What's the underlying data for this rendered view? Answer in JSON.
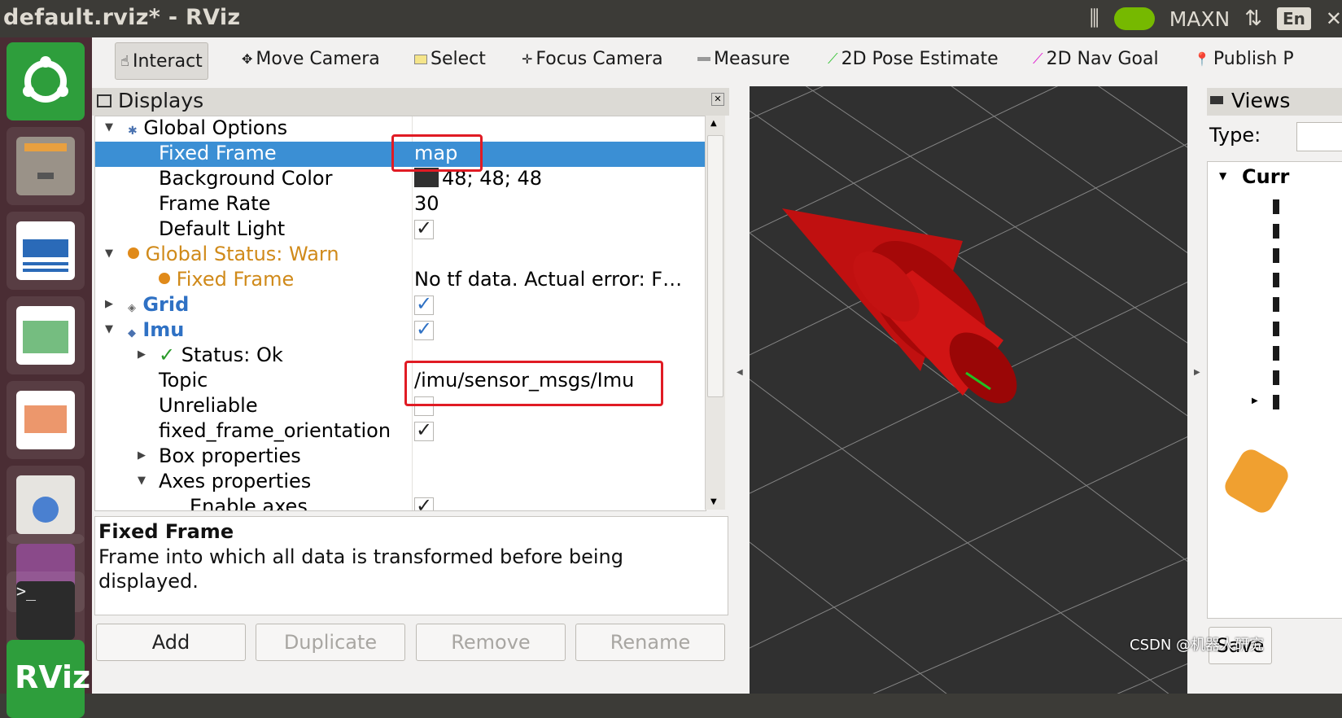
{
  "window": {
    "title": "default.rviz* - RViz",
    "tray": {
      "power_mode": "MAXN",
      "keyboard": "En"
    }
  },
  "toolbar": {
    "tools": [
      {
        "label": "Interact",
        "icon": "hand-icon"
      },
      {
        "label": "Move Camera",
        "icon": "move-icon"
      },
      {
        "label": "Select",
        "icon": "select-box-icon"
      },
      {
        "label": "Focus Camera",
        "icon": "focus-icon"
      },
      {
        "label": "Measure",
        "icon": "ruler-icon"
      },
      {
        "label": "2D Pose Estimate",
        "icon": "green-arrow-icon"
      },
      {
        "label": "2D Nav Goal",
        "icon": "magenta-arrow-icon"
      },
      {
        "label": "Publish P",
        "icon": "pin-icon"
      }
    ]
  },
  "displays": {
    "title": "Displays",
    "rows": [
      {
        "key": "Global Options",
        "value": ""
      },
      {
        "key": "Fixed Frame",
        "value": "map"
      },
      {
        "key": "Background Color",
        "value": "48; 48; 48"
      },
      {
        "key": "Frame Rate",
        "value": "30"
      },
      {
        "key": "Default Light",
        "value": ""
      },
      {
        "key": "Global Status: Warn",
        "value": ""
      },
      {
        "key": "Fixed Frame",
        "value": "No tf data.  Actual error: F…"
      },
      {
        "key": "Grid",
        "value": ""
      },
      {
        "key": "Imu",
        "value": ""
      },
      {
        "key": "Status: Ok",
        "value": ""
      },
      {
        "key": "Topic",
        "value": "/imu/sensor_msgs/Imu"
      },
      {
        "key": "Unreliable",
        "value": ""
      },
      {
        "key": "fixed_frame_orientation",
        "value": ""
      },
      {
        "key": "Box properties",
        "value": ""
      },
      {
        "key": "Axes properties",
        "value": ""
      },
      {
        "key": "Enable axes",
        "value": ""
      }
    ],
    "background_color": "#303030",
    "description": {
      "title": "Fixed Frame",
      "body": "Frame into which all data is transformed before being displayed."
    },
    "buttons": {
      "add": "Add",
      "duplicate": "Duplicate",
      "remove": "Remove",
      "rename": "Rename"
    }
  },
  "views": {
    "title": "Views",
    "type_label": "Type:",
    "current": "Curr",
    "save": "Save"
  },
  "watermark": "CSDN @机器人研究"
}
